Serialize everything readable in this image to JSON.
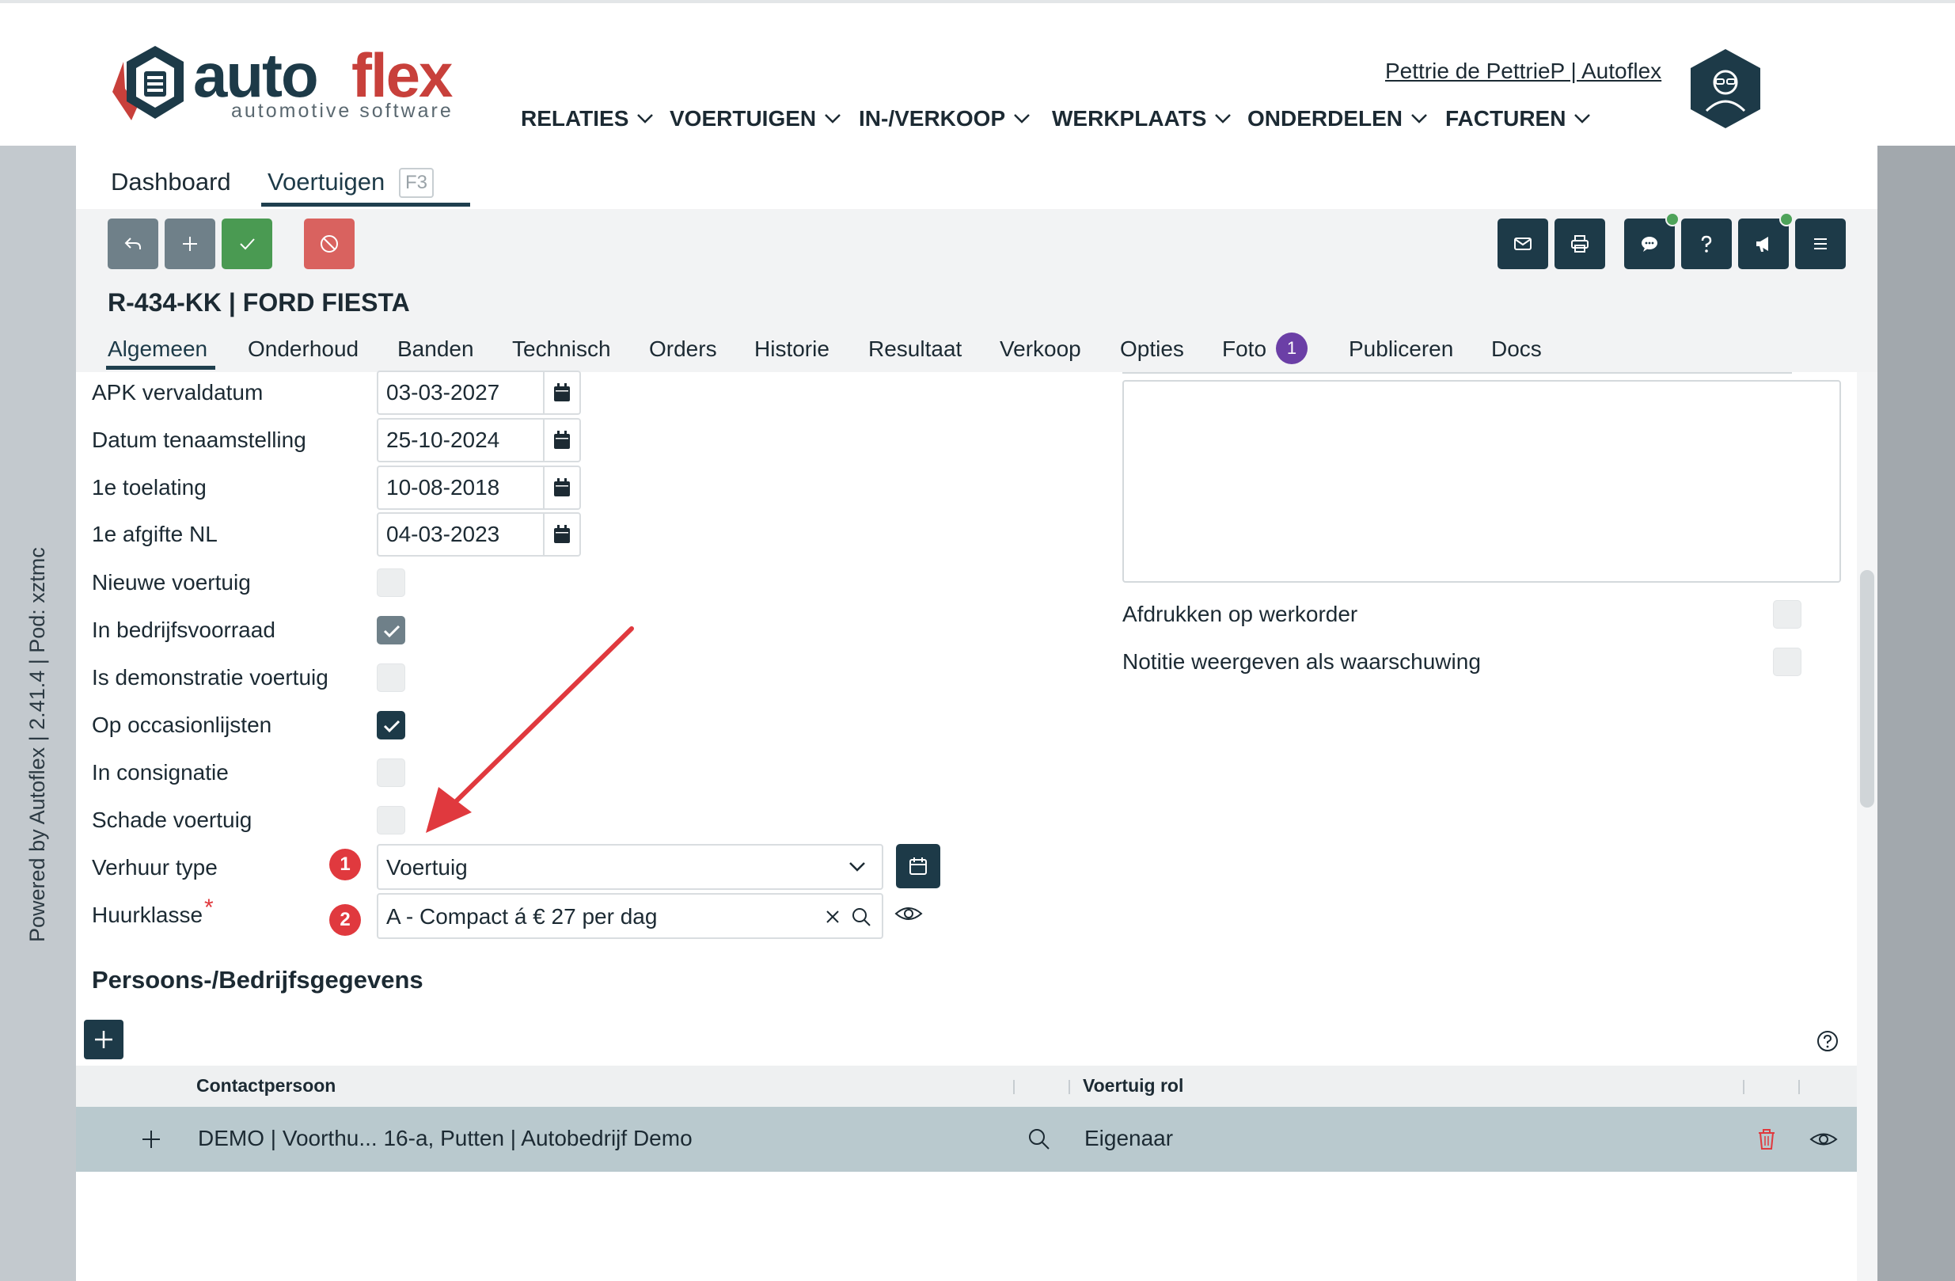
{
  "sidebar": {
    "powered_text": "Powered by Autoflex | 2.41.4 | Pod: xztmc"
  },
  "header": {
    "logo_word_main": "auto",
    "logo_word_accent": "flex",
    "logo_subtitle": "automotive software",
    "user_link": "Pettrie de PettrieP | Autoflex",
    "nav": [
      "RELATIES",
      "VOERTUIGEN",
      "IN-/VERKOOP",
      "WERKPLAATS",
      "ONDERDELEN",
      "FACTUREN"
    ]
  },
  "tabs": {
    "dashboard": "Dashboard",
    "voertuigen": "Voertuigen",
    "voertuigen_shortcut": "F3"
  },
  "vehicle": {
    "title": "R-434-KK | FORD FIESTA"
  },
  "subtabs": [
    "Algemeen",
    "Onderhoud",
    "Banden",
    "Technisch",
    "Orders",
    "Historie",
    "Resultaat",
    "Verkoop",
    "Opties",
    "Foto",
    "Publiceren",
    "Docs"
  ],
  "foto_badge": "1",
  "form": {
    "apk_label": "APK vervaldatum",
    "apk_value": "03-03-2027",
    "tenaamstelling_label": "Datum tenaamstelling",
    "tenaamstelling_value": "25-10-2024",
    "toelating_label": "1e toelating",
    "toelating_value": "10-08-2018",
    "afgifte_label": "1e afgifte NL",
    "afgifte_value": "04-03-2023",
    "nieuw_label": "Nieuwe voertuig",
    "nieuw_checked": false,
    "voorraad_label": "In bedrijfsvoorraad",
    "voorraad_checked": true,
    "demo_label": "Is demonstratie voertuig",
    "demo_checked": false,
    "occasion_label": "Op occasionlijsten",
    "occasion_checked": true,
    "consignatie_label": "In consignatie",
    "consignatie_checked": false,
    "schade_label": "Schade voertuig",
    "schade_checked": false,
    "verhuur_label": "Verhuur type",
    "verhuur_badge": "1",
    "verhuur_value": "Voertuig",
    "huurklasse_label": "Huurklasse",
    "huurklasse_required": "*",
    "huurklasse_badge": "2",
    "huurklasse_value": "A - Compact á € 27 per dag"
  },
  "notes": {
    "afdrukken_label": "Afdrukken op werkorder",
    "waarschuwing_label": "Notitie weergeven als waarschuwing"
  },
  "persons": {
    "section_title": "Persoons-/Bedrijfsgegevens",
    "columns": [
      "Contactpersoon",
      "Voertuig rol"
    ],
    "rows": [
      {
        "contact": "DEMO | Voorthu... 16-a, Putten | Autobedrijf Demo",
        "rol": "Eigenaar"
      }
    ]
  },
  "colors": {
    "brand_dark": "#1d3a48",
    "brand_red": "#c8403b",
    "save_green": "#4a9a52",
    "cancel_red": "#d9625f",
    "badge_red": "#e0393e",
    "badge_purple": "#6b3fa6",
    "arrow_red": "#e0393e"
  }
}
